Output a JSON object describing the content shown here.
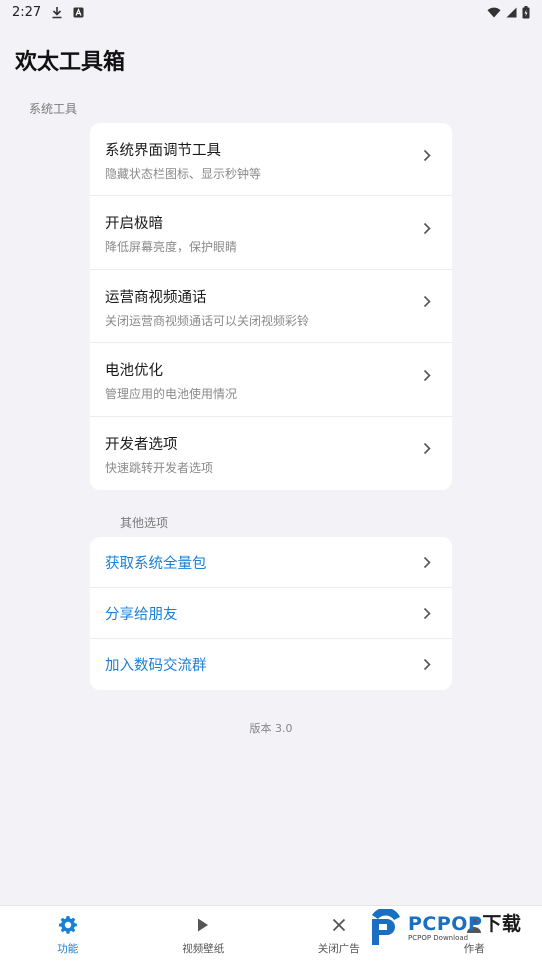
{
  "status_bar": {
    "time": "2:27",
    "icons": [
      "download-icon",
      "a-badge-icon",
      "wifi-icon",
      "signal-icon",
      "battery-icon"
    ]
  },
  "app": {
    "title": "欢太工具箱"
  },
  "sections": {
    "system": {
      "label": "系统工具",
      "items": [
        {
          "title": "系统界面调节工具",
          "subtitle": "隐藏状态栏图标、显示秒钟等"
        },
        {
          "title": "开启极暗",
          "subtitle": "降低屏幕亮度，保护眼睛"
        },
        {
          "title": "运营商视频通话",
          "subtitle": "关闭运营商视频通话可以关闭视频彩铃"
        },
        {
          "title": "电池优化",
          "subtitle": "管理应用的电池使用情况"
        },
        {
          "title": "开发者选项",
          "subtitle": "快速跳转开发者选项"
        }
      ]
    },
    "other": {
      "label": "其他选项",
      "items": [
        {
          "title": "获取系统全量包"
        },
        {
          "title": "分享给朋友"
        },
        {
          "title": "加入数码交流群"
        }
      ]
    }
  },
  "version": "版本 3.0",
  "bottom_nav": [
    {
      "label": "功能",
      "icon": "gear-icon",
      "active": true
    },
    {
      "label": "视频壁纸",
      "icon": "play-icon",
      "active": false
    },
    {
      "label": "关闭广告",
      "icon": "close-icon",
      "active": false
    },
    {
      "label": "作者",
      "icon": "person-icon",
      "active": false
    }
  ],
  "watermark": {
    "main": "PCPOP",
    "cn": "下载",
    "sub": "PCPOP Download"
  },
  "colors": {
    "accent": "#1a7fd6",
    "background": "#f2f2f7",
    "card": "#ffffff"
  }
}
